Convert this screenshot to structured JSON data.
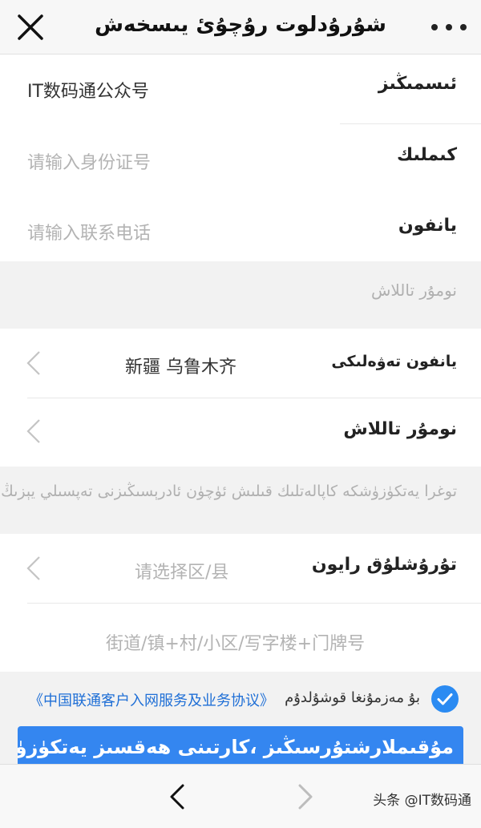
{
  "header": {
    "title": "شۇرۇدلوت رۇچۇئ يىسخەش",
    "close_icon": "close-icon",
    "more_icon": "more-dots-icon"
  },
  "form": {
    "rows": [
      {
        "label": "ئىسمىڭىز",
        "value": "IT数码通公众号"
      },
      {
        "label": "كىملىك",
        "placeholder": "请输入身份证号"
      },
      {
        "label": "يانفون",
        "placeholder": "请输入联系电话"
      }
    ],
    "number_select_header": "نومۇر تاللاش",
    "location": {
      "label": "يانفون تەۋەلىكى",
      "value": "新疆 乌鲁木齐"
    },
    "number_select": {
      "label": "نومۇر تاللاش"
    },
    "note": "توغرا يەتكۈزۈشكە كاپالەتلىك قىلىش ئۈچۈن ئادرېسىڭىزنى تەپسىلي يېزىڭ",
    "district": {
      "label": "تۇرۇشلۇق رايون",
      "placeholder": "请选择区/县"
    },
    "address": {
      "placeholder": "街道/镇+村/小区/写字楼+门牌号"
    }
  },
  "agreement": {
    "ug_text": "بۇ مەزمۇنغا قوشۇلدۇم",
    "link_text": "《中国联通客户入网服务及业务协议》",
    "checked": true
  },
  "submit": {
    "label": "مۇقىملارشتۇرسىڭىز ،كارتىنى ھەقسىز يەتكۈزۈپ بېرىمىز"
  },
  "bottom": {
    "back_icon": "chevron-left-icon",
    "forward_icon": "chevron-right-icon",
    "watermark": "头条 @IT数码通"
  },
  "colors": {
    "accent": "#3486f0",
    "check": "#2b8bf2",
    "link": "#1f6fd6",
    "background": "#f2f2f2"
  }
}
